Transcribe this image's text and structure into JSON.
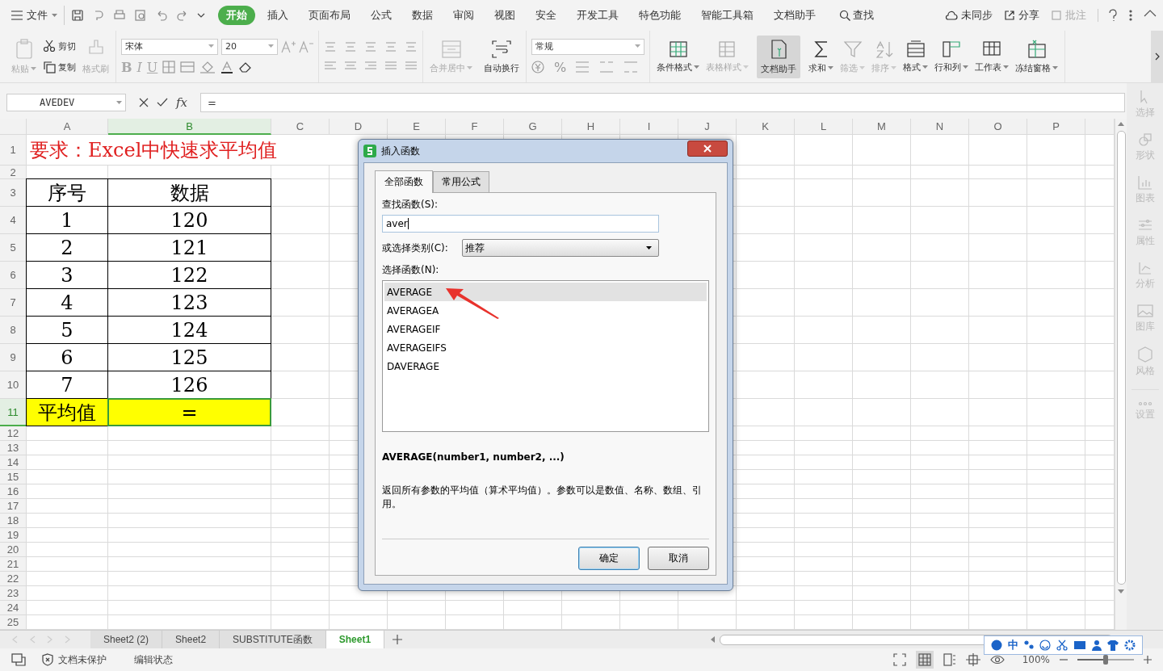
{
  "menu_bar": {
    "file_menu": "文件",
    "tabs": [
      {
        "label": "开始",
        "selected": true
      },
      {
        "label": "插入",
        "selected": false
      },
      {
        "label": "页面布局",
        "selected": false
      },
      {
        "label": "公式",
        "selected": false
      },
      {
        "label": "数据",
        "selected": false
      },
      {
        "label": "审阅",
        "selected": false
      },
      {
        "label": "视图",
        "selected": false
      },
      {
        "label": "安全",
        "selected": false
      },
      {
        "label": "开发工具",
        "selected": false
      },
      {
        "label": "特色功能",
        "selected": false
      },
      {
        "label": "智能工具箱",
        "selected": false
      },
      {
        "label": "文档助手",
        "selected": false
      }
    ],
    "search": "查找",
    "right": [
      {
        "label": "未同步",
        "disabled": false
      },
      {
        "label": "分享",
        "disabled": false
      },
      {
        "label": "批注",
        "disabled": true
      }
    ]
  },
  "ribbon": {
    "clipboard": [
      {
        "label": "粘贴",
        "disabled": true
      },
      {
        "label": "剪切",
        "disabled": false
      },
      {
        "label": "复制",
        "disabled": false
      },
      {
        "label": "格式刷",
        "disabled": true
      }
    ],
    "font_name": "宋体",
    "font_size": "20",
    "font_styles": [
      "B",
      "I",
      "U"
    ],
    "merge": [
      {
        "label": "合并居中",
        "disabled": true
      },
      {
        "label": "自动换行",
        "disabled": false
      }
    ],
    "number_format": "常规",
    "number_buttons": [
      "%"
    ],
    "tools": [
      {
        "label": "条件格式",
        "disabled": false,
        "selected": false
      },
      {
        "label": "表格样式",
        "disabled": true,
        "selected": false
      },
      {
        "label": "文档助手",
        "disabled": false,
        "selected": true
      },
      {
        "label": "求和",
        "disabled": false,
        "selected": false
      },
      {
        "label": "筛选",
        "disabled": true,
        "selected": false
      },
      {
        "label": "排序",
        "disabled": true,
        "selected": false
      },
      {
        "label": "格式",
        "disabled": false,
        "selected": false
      },
      {
        "label": "行和列",
        "disabled": false,
        "selected": false
      },
      {
        "label": "工作表",
        "disabled": false,
        "selected": false
      },
      {
        "label": "冻结窗格",
        "disabled": false,
        "selected": false
      }
    ]
  },
  "formula_bar": {
    "name_box": "AVEDEV",
    "function_label": "fx",
    "formula": "="
  },
  "sheet": {
    "columns": [
      {
        "label": "A",
        "selected": false
      },
      {
        "label": "B",
        "selected": true
      },
      {
        "label": "C",
        "selected": false
      },
      {
        "label": "D",
        "selected": false
      },
      {
        "label": "E",
        "selected": false
      },
      {
        "label": "F",
        "selected": false
      },
      {
        "label": "G",
        "selected": false
      },
      {
        "label": "H",
        "selected": false
      },
      {
        "label": "I",
        "selected": false
      },
      {
        "label": "J",
        "selected": false
      },
      {
        "label": "K",
        "selected": false
      },
      {
        "label": "L",
        "selected": false
      },
      {
        "label": "M",
        "selected": false
      },
      {
        "label": "N",
        "selected": false
      },
      {
        "label": "O",
        "selected": false
      },
      {
        "label": "P",
        "selected": false
      }
    ],
    "rows": [
      {
        "label": "1",
        "kind": "title",
        "selected": false,
        "cells": [
          "要求：Excel中快速求平均值"
        ]
      },
      {
        "label": "2",
        "kind": "blank",
        "selected": false
      },
      {
        "label": "3",
        "kind": "table",
        "selected": false,
        "highlighted": false,
        "cells": [
          "序号",
          "数据"
        ]
      },
      {
        "label": "4",
        "kind": "table",
        "selected": false,
        "highlighted": false,
        "cells": [
          "1",
          "120"
        ]
      },
      {
        "label": "5",
        "kind": "table",
        "selected": false,
        "highlighted": false,
        "cells": [
          "2",
          "121"
        ]
      },
      {
        "label": "6",
        "kind": "table",
        "selected": false,
        "highlighted": false,
        "cells": [
          "3",
          "122"
        ]
      },
      {
        "label": "7",
        "kind": "table",
        "selected": false,
        "highlighted": false,
        "cells": [
          "4",
          "123"
        ]
      },
      {
        "label": "8",
        "kind": "table",
        "selected": false,
        "highlighted": false,
        "cells": [
          "5",
          "124"
        ]
      },
      {
        "label": "9",
        "kind": "table",
        "selected": false,
        "highlighted": false,
        "cells": [
          "6",
          "125"
        ]
      },
      {
        "label": "10",
        "kind": "table",
        "selected": false,
        "highlighted": false,
        "cells": [
          "7",
          "126"
        ]
      },
      {
        "label": "11",
        "kind": "table",
        "selected": true,
        "highlighted": true,
        "cells": [
          "平均值",
          "="
        ]
      },
      {
        "label": "12",
        "kind": "blank",
        "selected": false
      },
      {
        "label": "13",
        "kind": "blank",
        "selected": false
      },
      {
        "label": "14",
        "kind": "blank",
        "selected": false
      },
      {
        "label": "15",
        "kind": "blank",
        "selected": false
      },
      {
        "label": "16",
        "kind": "blank",
        "selected": false
      },
      {
        "label": "17",
        "kind": "blank",
        "selected": false
      },
      {
        "label": "18",
        "kind": "blank",
        "selected": false
      },
      {
        "label": "19",
        "kind": "blank",
        "selected": false
      },
      {
        "label": "20",
        "kind": "blank",
        "selected": false
      },
      {
        "label": "21",
        "kind": "blank",
        "selected": false
      },
      {
        "label": "22",
        "kind": "blank",
        "selected": false
      },
      {
        "label": "23",
        "kind": "blank",
        "selected": false
      },
      {
        "label": "24",
        "kind": "blank",
        "selected": false
      },
      {
        "label": "25",
        "kind": "blank",
        "selected": false
      }
    ]
  },
  "sidebar": [
    {
      "label": "选择",
      "disabled": true
    },
    {
      "label": "形状",
      "disabled": true
    },
    {
      "label": "图表",
      "disabled": true
    },
    {
      "label": "属性",
      "disabled": true
    },
    {
      "label": "分析",
      "disabled": true
    },
    {
      "label": "图库",
      "disabled": true
    },
    {
      "label": "风格",
      "disabled": true
    },
    {
      "label": "设置",
      "disabled": true
    }
  ],
  "sheet_tabs": [
    {
      "label": "Sheet2 (2)",
      "selected": false
    },
    {
      "label": "Sheet2",
      "selected": false
    },
    {
      "label": "SUBSTITUTE函数",
      "selected": false
    },
    {
      "label": "Sheet1",
      "selected": true
    }
  ],
  "status_bar": {
    "protection": "文档未保护",
    "mode": "编辑状态",
    "zoom": "100%",
    "zoom_slider": {
      "level": 0.5
    }
  },
  "ime_bar": {
    "language": "中"
  },
  "dialog": {
    "title": "插入函数",
    "tabs": [
      {
        "label": "全部函数",
        "selected": true
      },
      {
        "label": "常用公式",
        "selected": false
      }
    ],
    "search_label": "查找函数(S):",
    "search_value": "aver",
    "category_label": "或选择类别(C):",
    "category": "推荐",
    "list_label": "选择函数(N):",
    "functions": [
      {
        "name": "AVERAGE",
        "selected": true
      },
      {
        "name": "AVERAGEA",
        "selected": false
      },
      {
        "name": "AVERAGEIF",
        "selected": false
      },
      {
        "name": "AVERAGEIFS",
        "selected": false
      },
      {
        "name": "DAVERAGE",
        "selected": false
      }
    ],
    "signature": "AVERAGE(number1, number2, ...)",
    "description": "返回所有参数的平均值（算术平均值）。参数可以是数值、名称、数组、引用。",
    "buttons": [
      {
        "label": "确定",
        "default": true
      },
      {
        "label": "取消",
        "default": false
      }
    ]
  }
}
